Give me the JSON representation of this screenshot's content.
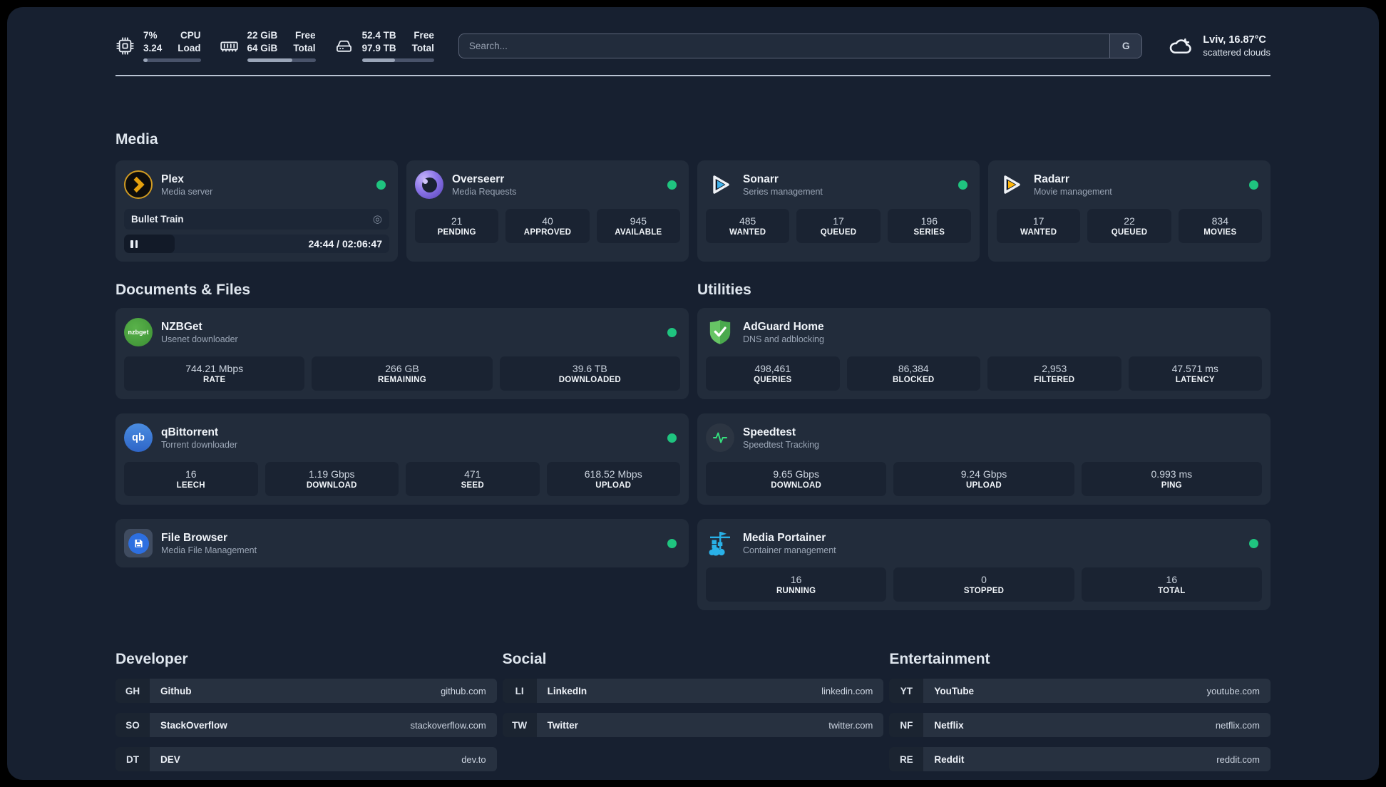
{
  "app": {
    "search_placeholder": "Search...",
    "search_provider": "G"
  },
  "metrics": {
    "cpu": {
      "value_top": "7%",
      "value_bottom": "3.24",
      "label_top": "CPU",
      "label_bottom": "Load",
      "progress": 7
    },
    "ram": {
      "value_top": "22 GiB",
      "value_bottom": "64 GiB",
      "label_top": "Free",
      "label_bottom": "Total",
      "progress": 66
    },
    "disk": {
      "value_top": "52.4 TB",
      "value_bottom": "97.9 TB",
      "label_top": "Free",
      "label_bottom": "Total",
      "progress": 46
    }
  },
  "weather": {
    "location": "Lviv, 16.87°C",
    "condition": "scattered clouds"
  },
  "sections": {
    "media": "Media",
    "documents": "Documents & Files",
    "utilities": "Utilities",
    "developer": "Developer",
    "social": "Social",
    "entertainment": "Entertainment"
  },
  "apps": {
    "plex": {
      "name": "Plex",
      "desc": "Media server",
      "now_playing": "Bullet Train",
      "time": "24:44 / 02:06:47",
      "progress": 19
    },
    "overseerr": {
      "name": "Overseerr",
      "desc": "Media Requests",
      "stats": [
        {
          "value": "21",
          "label": "PENDING"
        },
        {
          "value": "40",
          "label": "APPROVED"
        },
        {
          "value": "945",
          "label": "AVAILABLE"
        }
      ]
    },
    "sonarr": {
      "name": "Sonarr",
      "desc": "Series management",
      "stats": [
        {
          "value": "485",
          "label": "WANTED"
        },
        {
          "value": "17",
          "label": "QUEUED"
        },
        {
          "value": "196",
          "label": "SERIES"
        }
      ]
    },
    "radarr": {
      "name": "Radarr",
      "desc": "Movie management",
      "stats": [
        {
          "value": "17",
          "label": "WANTED"
        },
        {
          "value": "22",
          "label": "QUEUED"
        },
        {
          "value": "834",
          "label": "MOVIES"
        }
      ]
    },
    "nzbget": {
      "name": "NZBGet",
      "desc": "Usenet downloader",
      "icon_text": "nzbget",
      "stats": [
        {
          "value": "744.21 Mbps",
          "label": "RATE"
        },
        {
          "value": "266 GB",
          "label": "REMAINING"
        },
        {
          "value": "39.6 TB",
          "label": "DOWNLOADED"
        }
      ]
    },
    "qbittorrent": {
      "name": "qBittorrent",
      "desc": "Torrent downloader",
      "icon_text": "qb",
      "stats": [
        {
          "value": "16",
          "label": "LEECH"
        },
        {
          "value": "1.19 Gbps",
          "label": "DOWNLOAD"
        },
        {
          "value": "471",
          "label": "SEED"
        },
        {
          "value": "618.52 Mbps",
          "label": "UPLOAD"
        }
      ]
    },
    "filebrowser": {
      "name": "File Browser",
      "desc": "Media File Management"
    },
    "adguard": {
      "name": "AdGuard Home",
      "desc": "DNS and adblocking",
      "stats": [
        {
          "value": "498,461",
          "label": "QUERIES"
        },
        {
          "value": "86,384",
          "label": "BLOCKED"
        },
        {
          "value": "2,953",
          "label": "FILTERED"
        },
        {
          "value": "47.571 ms",
          "label": "LATENCY"
        }
      ]
    },
    "speedtest": {
      "name": "Speedtest",
      "desc": "Speedtest Tracking",
      "stats": [
        {
          "value": "9.65 Gbps",
          "label": "DOWNLOAD"
        },
        {
          "value": "9.24 Gbps",
          "label": "UPLOAD"
        },
        {
          "value": "0.993 ms",
          "label": "PING"
        }
      ]
    },
    "portainer": {
      "name": "Media Portainer",
      "desc": "Container management",
      "stats": [
        {
          "value": "16",
          "label": "RUNNING"
        },
        {
          "value": "0",
          "label": "STOPPED"
        },
        {
          "value": "16",
          "label": "TOTAL"
        }
      ]
    }
  },
  "bookmarks": {
    "developer": [
      {
        "abbr": "GH",
        "name": "Github",
        "url": "github.com"
      },
      {
        "abbr": "SO",
        "name": "StackOverflow",
        "url": "stackoverflow.com"
      },
      {
        "abbr": "DT",
        "name": "DEV",
        "url": "dev.to"
      }
    ],
    "social": [
      {
        "abbr": "LI",
        "name": "LinkedIn",
        "url": "linkedin.com"
      },
      {
        "abbr": "TW",
        "name": "Twitter",
        "url": "twitter.com"
      }
    ],
    "entertainment": [
      {
        "abbr": "YT",
        "name": "YouTube",
        "url": "youtube.com"
      },
      {
        "abbr": "NF",
        "name": "Netflix",
        "url": "netflix.com"
      },
      {
        "abbr": "RE",
        "name": "Reddit",
        "url": "reddit.com"
      }
    ]
  },
  "colors": {
    "accent_green": "#1fc47f",
    "plex_amber": "#e5a00d",
    "sonarr_blue": "#3fb1ea",
    "radarr_yellow": "#ffb60a",
    "portainer_blue": "#29b1e8",
    "adguard_green": "#5bb85c",
    "qbittorrent_blue": "#3d7edb",
    "overseerr_purple": "#8b75e8",
    "nzbget_green": "#3f9e3b",
    "speedtest_pulse": "#35e07e"
  }
}
